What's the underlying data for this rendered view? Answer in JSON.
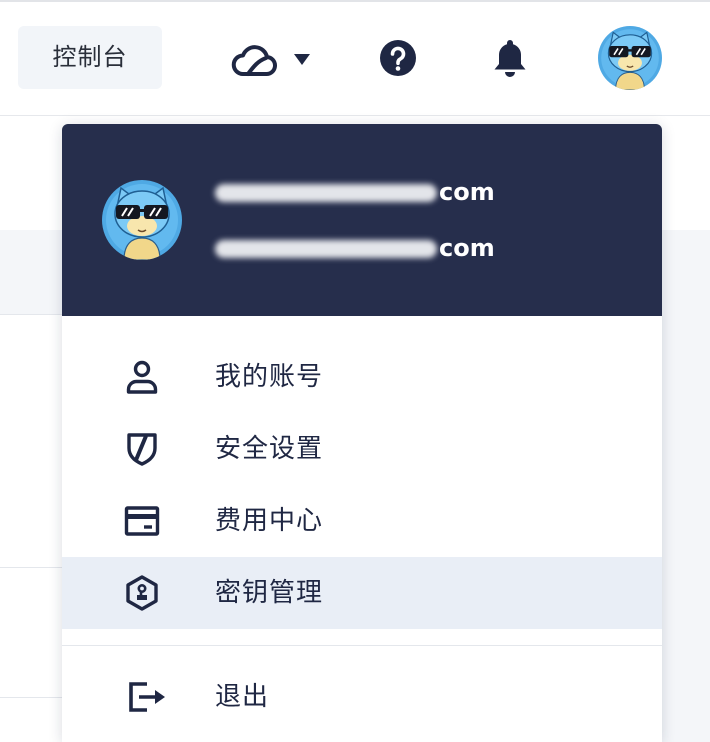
{
  "header": {
    "console_button": "控制台",
    "icons": {
      "cloud": "cloud-icon",
      "dropdown": "caret-down-icon",
      "help": "help-circle-icon",
      "notifications": "bell-icon",
      "account": "avatar"
    }
  },
  "account": {
    "email_primary_visible": "com",
    "email_secondary_visible": "com"
  },
  "menu": {
    "items": [
      {
        "label": "我的账号",
        "icon": "user-icon"
      },
      {
        "label": "安全设置",
        "icon": "shield-icon"
      },
      {
        "label": "费用中心",
        "icon": "billing-card-icon"
      },
      {
        "label": "密钥管理",
        "icon": "key-hexagon-icon",
        "highlighted": true
      }
    ],
    "logout": {
      "label": "退出",
      "icon": "logout-icon"
    }
  },
  "colors": {
    "header_navy": "#262e4c",
    "icon_dark": "#1f2743",
    "highlight_row": "#e9eef6",
    "console_button_bg": "#f2f5f9",
    "page_gray": "#f4f6f9"
  }
}
